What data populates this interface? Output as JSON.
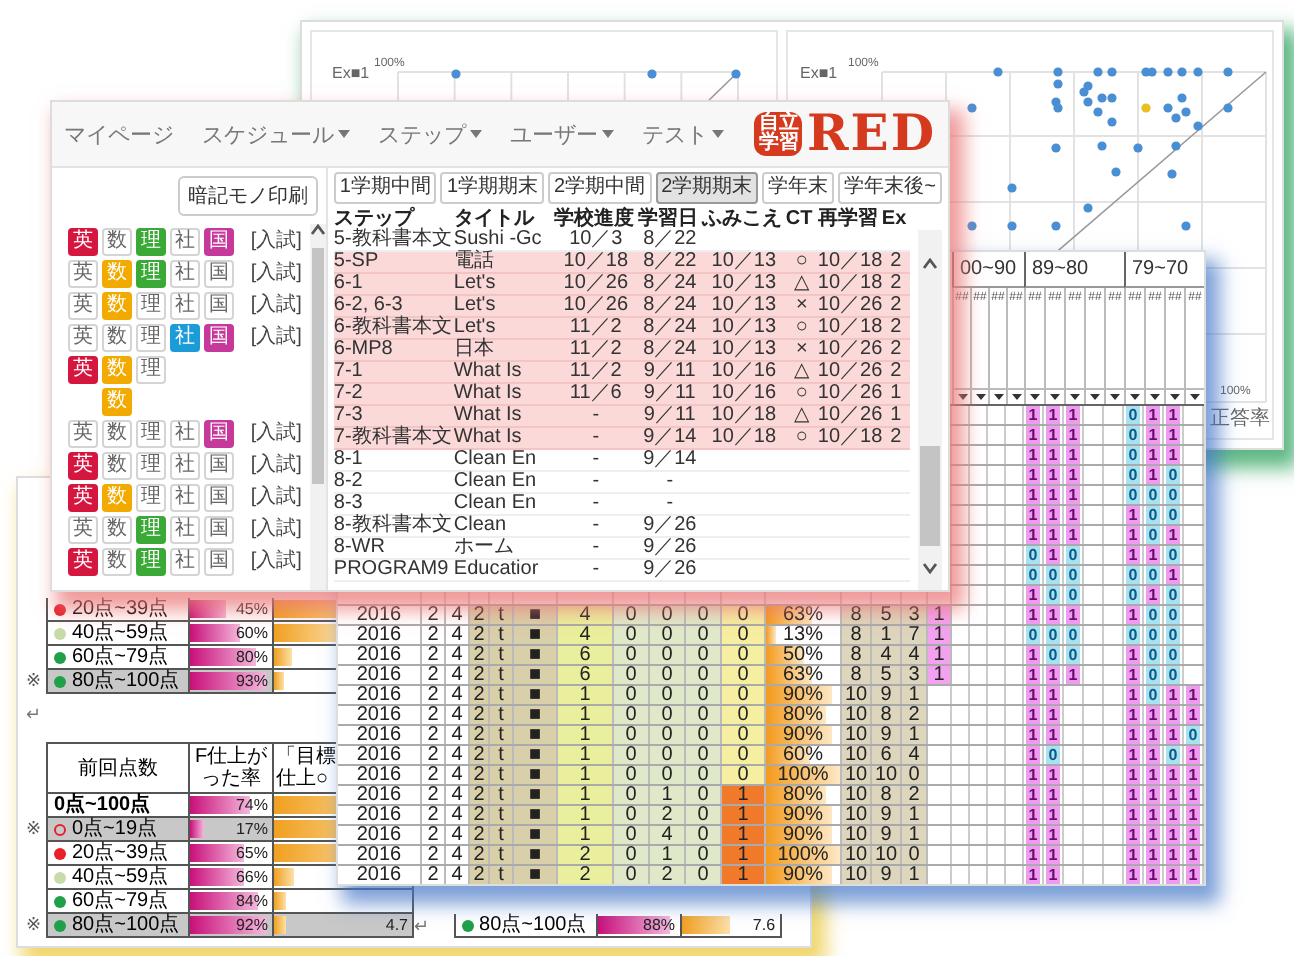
{
  "charts_window": {
    "panels": [
      {
        "kind": "sparse",
        "series_label": "Ex■1",
        "y_tick": "100%"
      },
      {
        "kind": "dense",
        "series_label": "Ex■1",
        "y_tick": "100%",
        "x_tick": "100%",
        "x_label": "正答率"
      }
    ]
  },
  "report_window": {
    "top_table": [
      {
        "kind": "dot",
        "color": "#e8202a",
        "label": "20点~39点",
        "pct": "45%",
        "level": 0.45,
        "bar2": {
          "level": 0.9
        }
      },
      {
        "kind": "dot",
        "color": "#c8dca8",
        "label": "40点~59点",
        "pct": "60%",
        "level": 0.6,
        "bar2": {
          "level": 0.6
        }
      },
      {
        "kind": "dot",
        "color": "#20a048",
        "label": "60点~79点",
        "pct": "80%",
        "level": 0.8,
        "bar2": {
          "level": 0.15
        }
      },
      {
        "mark": "※",
        "kind": "dot",
        "color": "#20a048",
        "label": "80点~100点",
        "pct": "93%",
        "level": 0.93,
        "bar2": {
          "level": 0.08
        },
        "grey": true
      }
    ],
    "top_end_mark": "↵",
    "score_table": {
      "headers": [
        "前回点数",
        "F仕上がった率",
        "「目標仕上○"
      ],
      "rows": [
        {
          "label": "0点~100点",
          "total": true,
          "pct": "74%",
          "level": 0.74,
          "bar2": {
            "level": 0.9
          }
        },
        {
          "mark": "※",
          "kind": "ring",
          "color": "#e8202a",
          "label": "0点~19点",
          "pct": "17%",
          "level": 0.17,
          "bar2": {
            "level": 0.9
          },
          "grey": true
        },
        {
          "kind": "dot",
          "color": "#e8202a",
          "label": "20点~39点",
          "pct": "65%",
          "level": 0.65,
          "bar2": {
            "level": 0.8
          }
        },
        {
          "kind": "dot",
          "color": "#c8dca8",
          "label": "40点~59点",
          "pct": "66%",
          "level": 0.66,
          "bar2": {
            "level": 0.15
          }
        },
        {
          "kind": "dot",
          "color": "#20a048",
          "label": "60点~79点",
          "pct": "84%",
          "level": 0.84,
          "bar2": {
            "level": 0.08
          }
        },
        {
          "mark": "※",
          "kind": "dot",
          "color": "#20a048",
          "label": "80点~100点",
          "pct": "92%",
          "level": 0.92,
          "bar2": {
            "level": 0.08
          },
          "grey": true,
          "goal": "4.7"
        }
      ],
      "end_mark": "↵"
    },
    "summary_row": {
      "kind": "dot",
      "color": "#20a048",
      "label": "80点~100点",
      "pct": "88%",
      "level": 0.88,
      "bar2": {
        "level": 0.5
      },
      "value": "7.6"
    }
  },
  "grid_window": {
    "groups": [
      {
        "label": "00~90",
        "subheads": [
          "##",
          "##",
          "##",
          "##"
        ]
      },
      {
        "label": "89~80",
        "subheads": [
          "##",
          "##",
          "##",
          "##",
          "##"
        ]
      },
      {
        "label": "79~70",
        "subheads": [
          "##",
          "##",
          "##",
          "##"
        ]
      }
    ],
    "rows": [
      {
        "cells": [
          {
            "t": "1",
            "kind": "hit"
          },
          {
            "t": "1",
            "kind": "hit"
          },
          {
            "t": "1",
            "kind": "hit"
          },
          null,
          null,
          {
            "t": "0",
            "kind": "miss"
          },
          {
            "t": "1",
            "kind": "hit"
          },
          {
            "t": "1",
            "kind": "hit"
          },
          null
        ]
      },
      {
        "cells": [
          {
            "t": "1",
            "kind": "hit"
          },
          {
            "t": "1",
            "kind": "hit"
          },
          {
            "t": "1",
            "kind": "hit"
          },
          null,
          null,
          {
            "t": "0",
            "kind": "miss"
          },
          {
            "t": "1",
            "kind": "hit"
          },
          {
            "t": "1",
            "kind": "hit"
          },
          null
        ]
      },
      {
        "cells": [
          {
            "t": "1",
            "kind": "hit"
          },
          {
            "t": "1",
            "kind": "hit"
          },
          {
            "t": "1",
            "kind": "hit"
          },
          null,
          null,
          {
            "t": "0",
            "kind": "miss"
          },
          {
            "t": "1",
            "kind": "hit"
          },
          {
            "t": "1",
            "kind": "hit"
          },
          null
        ]
      },
      {
        "cells": [
          {
            "t": "1",
            "kind": "hit"
          },
          {
            "t": "1",
            "kind": "hit"
          },
          {
            "t": "1",
            "kind": "hit"
          },
          null,
          null,
          {
            "t": "0",
            "kind": "miss"
          },
          {
            "t": "1",
            "kind": "hit"
          },
          {
            "t": "0",
            "kind": "miss"
          },
          null
        ]
      },
      {
        "cells": [
          {
            "t": "1",
            "kind": "hit"
          },
          {
            "t": "1",
            "kind": "hit"
          },
          {
            "t": "1",
            "kind": "hit"
          },
          null,
          null,
          {
            "t": "0",
            "kind": "miss"
          },
          {
            "t": "0",
            "kind": "miss"
          },
          {
            "t": "0",
            "kind": "miss"
          },
          null
        ]
      },
      {
        "cells": [
          {
            "t": "1",
            "kind": "hit"
          },
          {
            "t": "1",
            "kind": "hit"
          },
          {
            "t": "1",
            "kind": "hit"
          },
          null,
          null,
          {
            "t": "1",
            "kind": "hit"
          },
          {
            "t": "0",
            "kind": "miss"
          },
          {
            "t": "0",
            "kind": "miss"
          },
          null
        ]
      },
      {
        "cells": [
          {
            "t": "1",
            "kind": "hit"
          },
          {
            "t": "1",
            "kind": "hit"
          },
          {
            "t": "1",
            "kind": "hit"
          },
          null,
          null,
          {
            "t": "1",
            "kind": "hit"
          },
          {
            "t": "0",
            "kind": "miss"
          },
          {
            "t": "1",
            "kind": "hit"
          },
          null
        ]
      },
      {
        "cells": [
          {
            "t": "0",
            "kind": "miss"
          },
          {
            "t": "1",
            "kind": "hit"
          },
          {
            "t": "0",
            "kind": "miss"
          },
          null,
          null,
          {
            "t": "1",
            "kind": "hit"
          },
          {
            "t": "1",
            "kind": "hit"
          },
          {
            "t": "0",
            "kind": "miss"
          },
          null
        ]
      },
      {
        "cells": [
          {
            "t": "0",
            "kind": "miss"
          },
          {
            "t": "0",
            "kind": "miss"
          },
          {
            "t": "0",
            "kind": "miss"
          },
          null,
          null,
          {
            "t": "0",
            "kind": "miss"
          },
          {
            "t": "0",
            "kind": "miss"
          },
          {
            "t": "1",
            "kind": "hit"
          },
          null
        ]
      },
      {
        "cells": [
          {
            "t": "1",
            "kind": "hit"
          },
          {
            "t": "0",
            "kind": "miss"
          },
          {
            "t": "0",
            "kind": "miss"
          },
          null,
          null,
          {
            "t": "0",
            "kind": "miss"
          },
          {
            "t": "1",
            "kind": "hit"
          },
          {
            "t": "0",
            "kind": "miss"
          },
          null
        ]
      },
      {
        "values": [
          "2016",
          "2",
          "4",
          "2",
          "t",
          "■",
          "4",
          "0",
          "0",
          "0",
          "0",
          "63%",
          "8",
          "5",
          "3",
          "1"
        ],
        "flag_on": false,
        "level": 0.63,
        "cells": [
          {
            "t": "1",
            "kind": "hit"
          },
          {
            "t": "1",
            "kind": "hit"
          },
          {
            "t": "1",
            "kind": "hit"
          },
          null,
          null,
          {
            "t": "1",
            "kind": "hit"
          },
          {
            "t": "0",
            "kind": "miss"
          },
          {
            "t": "0",
            "kind": "miss"
          },
          null
        ]
      },
      {
        "values": [
          "2016",
          "2",
          "4",
          "2",
          "t",
          "■",
          "4",
          "0",
          "0",
          "0",
          "0",
          "13%",
          "8",
          "1",
          "7",
          "1"
        ],
        "flag_on": false,
        "level": 0.13,
        "cells": [
          {
            "t": "0",
            "kind": "miss"
          },
          {
            "t": "0",
            "kind": "miss"
          },
          {
            "t": "0",
            "kind": "miss"
          },
          null,
          null,
          {
            "t": "0",
            "kind": "miss"
          },
          {
            "t": "0",
            "kind": "miss"
          },
          {
            "t": "0",
            "kind": "miss"
          },
          null
        ]
      },
      {
        "values": [
          "2016",
          "2",
          "4",
          "2",
          "t",
          "■",
          "6",
          "0",
          "0",
          "0",
          "0",
          "50%",
          "8",
          "4",
          "4",
          "1"
        ],
        "flag_on": false,
        "level": 0.5,
        "cells": [
          {
            "t": "1",
            "kind": "hit"
          },
          {
            "t": "0",
            "kind": "miss"
          },
          {
            "t": "0",
            "kind": "miss"
          },
          null,
          null,
          {
            "t": "1",
            "kind": "hit"
          },
          {
            "t": "0",
            "kind": "miss"
          },
          {
            "t": "0",
            "kind": "miss"
          },
          null
        ]
      },
      {
        "values": [
          "2016",
          "2",
          "4",
          "2",
          "t",
          "■",
          "6",
          "0",
          "0",
          "0",
          "0",
          "63%",
          "8",
          "5",
          "3",
          "1"
        ],
        "flag_on": false,
        "level": 0.63,
        "cells": [
          {
            "t": "1",
            "kind": "hit"
          },
          {
            "t": "1",
            "kind": "hit"
          },
          {
            "t": "1",
            "kind": "hit"
          },
          null,
          null,
          {
            "t": "1",
            "kind": "hit"
          },
          {
            "t": "0",
            "kind": "miss"
          },
          {
            "t": "0",
            "kind": "miss"
          },
          null
        ]
      },
      {
        "values": [
          "2016",
          "2",
          "4",
          "2",
          "t",
          "■",
          "1",
          "0",
          "0",
          "0",
          "0",
          "90%",
          "10",
          "9",
          "1"
        ],
        "flag_on": false,
        "level": 0.9,
        "cells": [
          {
            "t": "1",
            "kind": "hit"
          },
          {
            "t": "1",
            "kind": "hit"
          },
          null,
          null,
          null,
          {
            "t": "1",
            "kind": "hit"
          },
          {
            "t": "0",
            "kind": "miss"
          },
          {
            "t": "1",
            "kind": "hit"
          },
          {
            "t": "1",
            "kind": "hit"
          }
        ]
      },
      {
        "values": [
          "2016",
          "2",
          "4",
          "2",
          "t",
          "■",
          "1",
          "0",
          "0",
          "0",
          "0",
          "80%",
          "10",
          "8",
          "2"
        ],
        "flag_on": false,
        "level": 0.8,
        "cells": [
          {
            "t": "1",
            "kind": "hit"
          },
          {
            "t": "1",
            "kind": "hit"
          },
          null,
          null,
          null,
          {
            "t": "1",
            "kind": "hit"
          },
          {
            "t": "1",
            "kind": "hit"
          },
          {
            "t": "1",
            "kind": "hit"
          },
          {
            "t": "1",
            "kind": "hit"
          }
        ]
      },
      {
        "values": [
          "2016",
          "2",
          "4",
          "2",
          "t",
          "■",
          "1",
          "0",
          "0",
          "0",
          "0",
          "90%",
          "10",
          "9",
          "1"
        ],
        "flag_on": false,
        "level": 0.9,
        "cells": [
          {
            "t": "1",
            "kind": "hit"
          },
          {
            "t": "1",
            "kind": "hit"
          },
          null,
          null,
          null,
          {
            "t": "1",
            "kind": "hit"
          },
          {
            "t": "1",
            "kind": "hit"
          },
          {
            "t": "1",
            "kind": "hit"
          },
          {
            "t": "0",
            "kind": "miss"
          }
        ]
      },
      {
        "values": [
          "2016",
          "2",
          "4",
          "2",
          "t",
          "■",
          "1",
          "0",
          "0",
          "0",
          "0",
          "60%",
          "10",
          "6",
          "4"
        ],
        "flag_on": false,
        "level": 0.6,
        "cells": [
          {
            "t": "1",
            "kind": "hit"
          },
          {
            "t": "0",
            "kind": "miss"
          },
          null,
          null,
          null,
          {
            "t": "1",
            "kind": "hit"
          },
          {
            "t": "1",
            "kind": "hit"
          },
          {
            "t": "0",
            "kind": "miss"
          },
          {
            "t": "1",
            "kind": "hit"
          }
        ]
      },
      {
        "values": [
          "2016",
          "2",
          "4",
          "2",
          "t",
          "■",
          "1",
          "0",
          "0",
          "0",
          "0",
          "100%",
          "10",
          "10",
          "0"
        ],
        "flag_on": false,
        "level": 1,
        "cells": [
          {
            "t": "1",
            "kind": "hit"
          },
          {
            "t": "1",
            "kind": "hit"
          },
          null,
          null,
          null,
          {
            "t": "1",
            "kind": "hit"
          },
          {
            "t": "1",
            "kind": "hit"
          },
          {
            "t": "1",
            "kind": "hit"
          },
          {
            "t": "1",
            "kind": "hit"
          }
        ]
      },
      {
        "values": [
          "2016",
          "2",
          "4",
          "2",
          "t",
          "■",
          "1",
          "0",
          "1",
          "0",
          "1",
          "80%",
          "10",
          "8",
          "2"
        ],
        "flag_on": true,
        "level": 0.8,
        "cells": [
          {
            "t": "1",
            "kind": "hit"
          },
          {
            "t": "1",
            "kind": "hit"
          },
          null,
          null,
          null,
          {
            "t": "1",
            "kind": "hit"
          },
          {
            "t": "1",
            "kind": "hit"
          },
          {
            "t": "1",
            "kind": "hit"
          },
          {
            "t": "1",
            "kind": "hit"
          }
        ]
      },
      {
        "values": [
          "2016",
          "2",
          "4",
          "2",
          "t",
          "■",
          "1",
          "0",
          "2",
          "0",
          "1",
          "90%",
          "10",
          "9",
          "1"
        ],
        "flag_on": true,
        "level": 0.9,
        "cells": [
          {
            "t": "1",
            "kind": "hit"
          },
          {
            "t": "1",
            "kind": "hit"
          },
          null,
          null,
          null,
          {
            "t": "1",
            "kind": "hit"
          },
          {
            "t": "1",
            "kind": "hit"
          },
          {
            "t": "1",
            "kind": "hit"
          },
          {
            "t": "1",
            "kind": "hit"
          }
        ]
      },
      {
        "values": [
          "2016",
          "2",
          "4",
          "2",
          "t",
          "■",
          "1",
          "0",
          "4",
          "0",
          "1",
          "90%",
          "10",
          "9",
          "1"
        ],
        "flag_on": true,
        "level": 0.9,
        "cells": [
          {
            "t": "1",
            "kind": "hit"
          },
          {
            "t": "1",
            "kind": "hit"
          },
          null,
          null,
          null,
          {
            "t": "1",
            "kind": "hit"
          },
          {
            "t": "1",
            "kind": "hit"
          },
          {
            "t": "1",
            "kind": "hit"
          },
          {
            "t": "1",
            "kind": "hit"
          }
        ]
      },
      {
        "values": [
          "2016",
          "2",
          "4",
          "2",
          "t",
          "■",
          "2",
          "0",
          "1",
          "0",
          "1",
          "100%",
          "10",
          "10",
          "0"
        ],
        "flag_on": true,
        "level": 1,
        "cells": [
          {
            "t": "1",
            "kind": "hit"
          },
          {
            "t": "1",
            "kind": "hit"
          },
          null,
          null,
          null,
          {
            "t": "1",
            "kind": "hit"
          },
          {
            "t": "1",
            "kind": "hit"
          },
          {
            "t": "1",
            "kind": "hit"
          },
          {
            "t": "1",
            "kind": "hit"
          }
        ]
      },
      {
        "values": [
          "2016",
          "2",
          "4",
          "2",
          "t",
          "■",
          "2",
          "0",
          "2",
          "0",
          "1",
          "90%",
          "10",
          "9",
          "1"
        ],
        "flag_on": true,
        "level": 0.9,
        "cells": [
          {
            "t": "1",
            "kind": "hit"
          },
          {
            "t": "1",
            "kind": "hit"
          },
          null,
          null,
          null,
          {
            "t": "1",
            "kind": "hit"
          },
          {
            "t": "1",
            "kind": "hit"
          },
          {
            "t": "1",
            "kind": "hit"
          },
          {
            "t": "1",
            "kind": "hit"
          }
        ]
      }
    ]
  },
  "main_window": {
    "menu": [
      {
        "label": "マイページ",
        "dropdown": false
      },
      {
        "label": "スケジュール",
        "dropdown": true
      },
      {
        "label": "ステップ",
        "dropdown": true
      },
      {
        "label": "ユーザー",
        "dropdown": true
      },
      {
        "label": "テスト",
        "dropdown": true
      }
    ],
    "logo": {
      "badge": [
        "自立",
        "学習"
      ],
      "text": "RED"
    },
    "print_button": "暗記モノ印刷",
    "subject_rows": [
      {
        "badges": [
          {
            "kind": "en",
            "label": "英",
            "on": true
          },
          {
            "kind": "math",
            "label": "数",
            "on": false
          },
          {
            "kind": "sci",
            "label": "理",
            "on": true
          },
          {
            "kind": "soc",
            "label": "社",
            "on": false
          },
          {
            "kind": "jp",
            "label": "国",
            "on": true
          }
        ],
        "tag": "[入試]"
      },
      {
        "badges": [
          {
            "kind": "en",
            "label": "英",
            "on": false
          },
          {
            "kind": "math",
            "label": "数",
            "on": true
          },
          {
            "kind": "sci",
            "label": "理",
            "on": true
          },
          {
            "kind": "soc",
            "label": "社",
            "on": false
          },
          {
            "kind": "jp",
            "label": "国",
            "on": false
          }
        ],
        "tag": "[入試]"
      },
      {
        "badges": [
          {
            "kind": "en",
            "label": "英",
            "on": false
          },
          {
            "kind": "math",
            "label": "数",
            "on": true
          },
          {
            "kind": "sci",
            "label": "理",
            "on": false
          },
          {
            "kind": "soc",
            "label": "社",
            "on": false
          },
          {
            "kind": "jp",
            "label": "国",
            "on": false
          }
        ],
        "tag": "[入試]"
      },
      {
        "badges": [
          {
            "kind": "en",
            "label": "英",
            "on": false
          },
          {
            "kind": "math",
            "label": "数",
            "on": false
          },
          {
            "kind": "sci",
            "label": "理",
            "on": false
          },
          {
            "kind": "soc",
            "label": "社",
            "on": true
          },
          {
            "kind": "jp",
            "label": "国",
            "on": true
          }
        ],
        "tag": "[入試]"
      },
      {
        "badges": [
          {
            "kind": "en",
            "label": "英",
            "on": true
          },
          {
            "kind": "math",
            "label": "数",
            "on": true
          },
          {
            "kind": "sci",
            "label": "理",
            "on": false
          }
        ]
      },
      {
        "badges": [
          {
            "kind": "math",
            "label": "数",
            "on": true
          }
        ]
      },
      {
        "badges": [
          {
            "kind": "en",
            "label": "英",
            "on": false
          },
          {
            "kind": "math",
            "label": "数",
            "on": false
          },
          {
            "kind": "sci",
            "label": "理",
            "on": false
          },
          {
            "kind": "soc",
            "label": "社",
            "on": false
          },
          {
            "kind": "jp",
            "label": "国",
            "on": true
          }
        ],
        "tag": "[入試]"
      },
      {
        "badges": [
          {
            "kind": "en",
            "label": "英",
            "on": true
          },
          {
            "kind": "math",
            "label": "数",
            "on": false
          },
          {
            "kind": "sci",
            "label": "理",
            "on": false
          },
          {
            "kind": "soc",
            "label": "社",
            "on": false
          },
          {
            "kind": "jp",
            "label": "国",
            "on": false
          }
        ],
        "tag": "[入試]"
      },
      {
        "badges": [
          {
            "kind": "en",
            "label": "英",
            "on": true
          },
          {
            "kind": "math",
            "label": "数",
            "on": true
          },
          {
            "kind": "sci",
            "label": "理",
            "on": false
          },
          {
            "kind": "soc",
            "label": "社",
            "on": false
          },
          {
            "kind": "jp",
            "label": "国",
            "on": false
          }
        ],
        "tag": "[入試]"
      },
      {
        "badges": [
          {
            "kind": "en",
            "label": "英",
            "on": false
          },
          {
            "kind": "math",
            "label": "数",
            "on": false
          },
          {
            "kind": "sci",
            "label": "理",
            "on": true
          },
          {
            "kind": "soc",
            "label": "社",
            "on": false
          },
          {
            "kind": "jp",
            "label": "国",
            "on": false
          }
        ],
        "tag": "[入試]"
      },
      {
        "badges": [
          {
            "kind": "en",
            "label": "英",
            "on": true
          },
          {
            "kind": "math",
            "label": "数",
            "on": false
          },
          {
            "kind": "sci",
            "label": "理",
            "on": true
          },
          {
            "kind": "soc",
            "label": "社",
            "on": false
          },
          {
            "kind": "jp",
            "label": "国",
            "on": false
          }
        ],
        "tag": "[入試]"
      }
    ],
    "tabs": [
      {
        "label": "1学期中間",
        "selected": false
      },
      {
        "label": "1学期期末",
        "selected": false
      },
      {
        "label": "2学期中間",
        "selected": false
      },
      {
        "label": "2学期期末",
        "selected": true
      },
      {
        "label": "学年末",
        "selected": false
      },
      {
        "label": "学年末後~",
        "selected": false
      }
    ],
    "columns": [
      "ステップ",
      "タイトル",
      "学校進度",
      "学習日",
      "ふみこえ",
      "CT",
      "再学習",
      "Ex"
    ],
    "rows": [
      {
        "cells": [
          "5-教科書本文",
          "Sushi -Gc",
          "10／3",
          "8／22",
          "",
          "",
          "",
          ""
        ],
        "highlight": false
      },
      {
        "cells": [
          "5-SP",
          "電話",
          "10／18",
          "8／22",
          "10／13",
          "○",
          "10／18",
          "2"
        ],
        "highlight": true
      },
      {
        "cells": [
          "6-1",
          "Let's",
          "10／26",
          "8／24",
          "10／13",
          "△",
          "10／18",
          "2"
        ],
        "highlight": true
      },
      {
        "cells": [
          "6-2, 6-3",
          "Let's",
          "10／26",
          "8／24",
          "10／13",
          "×",
          "10／26",
          "2"
        ],
        "highlight": true
      },
      {
        "cells": [
          "6-教科書本文",
          "Let's",
          "11／2",
          "8／24",
          "10／13",
          "○",
          "10／18",
          "2"
        ],
        "highlight": true
      },
      {
        "cells": [
          "6-MP8",
          "日本",
          "11／2",
          "8／24",
          "10／13",
          "×",
          "10／26",
          "2"
        ],
        "highlight": true
      },
      {
        "cells": [
          "7-1",
          "What Is",
          "11／2",
          "9／11",
          "10／16",
          "△",
          "10／26",
          "2"
        ],
        "highlight": true
      },
      {
        "cells": [
          "7-2",
          "What Is",
          "11／6",
          "9／11",
          "10／16",
          "○",
          "10／26",
          "1"
        ],
        "highlight": true
      },
      {
        "cells": [
          "7-3",
          "What Is",
          "-",
          "9／11",
          "10／18",
          "△",
          "10／26",
          "1"
        ],
        "highlight": true
      },
      {
        "cells": [
          "7-教科書本文",
          "What Is",
          "-",
          "9／14",
          "10／18",
          "○",
          "10／18",
          "2"
        ],
        "highlight": true
      },
      {
        "cells": [
          "8-1",
          "Clean En",
          "-",
          "9／14",
          "",
          "",
          "",
          ""
        ],
        "highlight": false
      },
      {
        "cells": [
          "8-2",
          "Clean En",
          "-",
          "-",
          "",
          "",
          "",
          ""
        ],
        "highlight": false
      },
      {
        "cells": [
          "8-3",
          "Clean En",
          "-",
          "-",
          "",
          "",
          "",
          ""
        ],
        "highlight": false
      },
      {
        "cells": [
          "8-教科書本文",
          "Clean",
          "-",
          "9／26",
          "",
          "",
          "",
          ""
        ],
        "highlight": false
      },
      {
        "cells": [
          "8-WR",
          "ホーム",
          "-",
          "9／26",
          "",
          "",
          "",
          ""
        ],
        "highlight": false
      },
      {
        "cells": [
          "PROGRAM9",
          "Educatior",
          "-",
          "9／26",
          "",
          "",
          "",
          ""
        ],
        "highlight": false
      }
    ]
  }
}
